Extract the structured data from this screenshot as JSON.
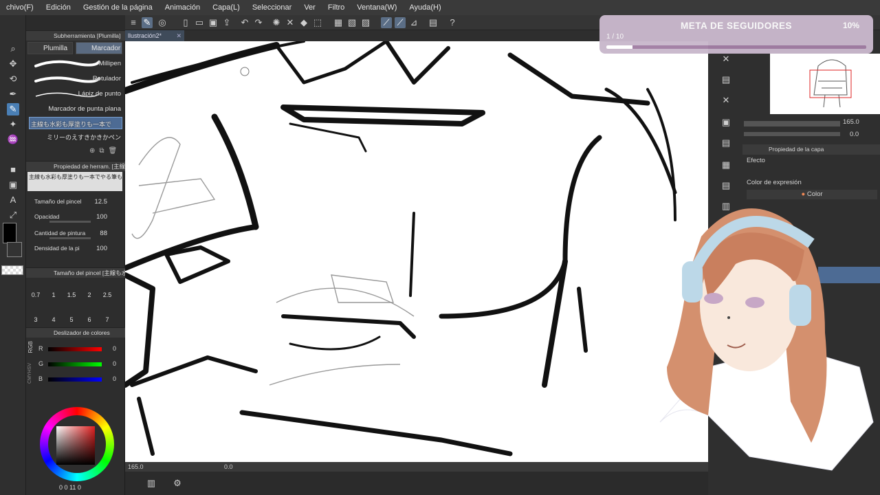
{
  "menu": [
    "chivo(F)",
    "Edición",
    "Gestión de la página",
    "Animación",
    "Capa(L)",
    "Seleccionar",
    "Ver",
    "Filtro",
    "Ventana(W)",
    "Ayuda(H)"
  ],
  "goal": {
    "title": "META DE SEGUIDORES",
    "progress_label": "1 / 10",
    "percent_label": "10%",
    "progress": 0.1
  },
  "doc": {
    "tab": "llustración2*"
  },
  "subtool": {
    "header": "Subherramienta [Plumilla]",
    "tab_pen": "Plumilla",
    "tab_marker": "Marcador",
    "brushes": [
      "Millipen",
      "Rotulador",
      "Lápiz de punto",
      "Marcador de punta plana",
      "主線も水彩も厚塗りも一本で",
      "ミリーのえすきかきかペン"
    ]
  },
  "toolprop": {
    "header": "Propiedad de herram. [主線も水",
    "brush_name": "主線も水彩も厚塗りも一本でやる筆ものがた",
    "size_label": "Tamaño del pincel",
    "size_value": "12.5",
    "opacity_label": "Opacidad",
    "opacity_value": "100",
    "ink_label": "Cantidad de pintura",
    "ink_value": "88",
    "density_label": "Densidad de la pi",
    "density_value": "100"
  },
  "brushsize": {
    "header": "Tamaño del pincel [主線も水",
    "row1": [
      "0.7",
      "1",
      "1.5",
      "2",
      "2.5"
    ],
    "row2": [
      "3",
      "4",
      "5",
      "6",
      "7"
    ]
  },
  "sliders": {
    "header": "Deslizador de colores",
    "mode": "RGB",
    "alt_mode": "CMYHSV",
    "r_label": "R",
    "r_value": "0",
    "g_label": "G",
    "g_value": "0",
    "b_label": "B",
    "b_value": "0"
  },
  "wheel": {
    "footer": "0 0 11 0"
  },
  "status": {
    "zoom": "165.0",
    "angle": "0.0"
  },
  "right": {
    "zoom_value": "165.0",
    "rot_value": "0.0",
    "layerprop": "Propiedad de la capa",
    "effect": "Efecto",
    "expr_color_label": "Color de expresión",
    "expr_color_value": "Color"
  },
  "colors": {
    "accent": "#4a7fb5",
    "goal_bg": "#c9b8cc",
    "goal_fill": "#ffffff"
  }
}
